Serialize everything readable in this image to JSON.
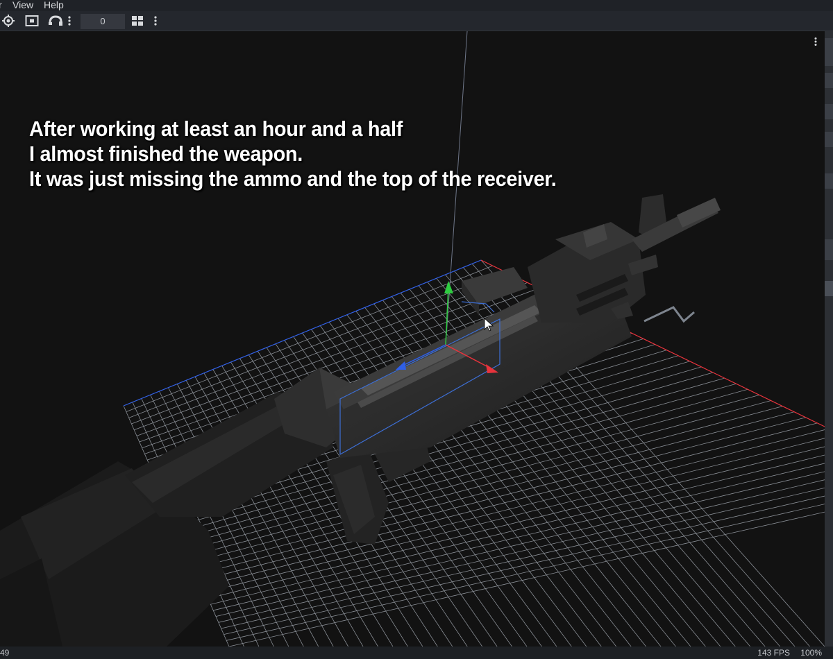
{
  "menu": {
    "items": [
      {
        "label": "r"
      },
      {
        "label": "View"
      },
      {
        "label": "Help"
      }
    ]
  },
  "toolbar": {
    "counter_value": "0",
    "icons": [
      "target-icon",
      "frame-icon",
      "snap-magnet-icon",
      "more-vertical-icon",
      "layout-icon",
      "more-vertical-icon"
    ]
  },
  "caption": {
    "lines": [
      "After working at least an hour and a half",
      "I almost finished the weapon.",
      "It was just missing the ammo and the top of the receiver."
    ]
  },
  "status": {
    "left": "49",
    "fps": "143 FPS",
    "zoom": "100%"
  },
  "colors": {
    "viewport_bg": "#121212",
    "grid": "#8a8f96",
    "axis_x": "#e8333c",
    "axis_y": "#2ecc40",
    "axis_z": "#2f5fe8",
    "selection": "#3d6fd6"
  }
}
